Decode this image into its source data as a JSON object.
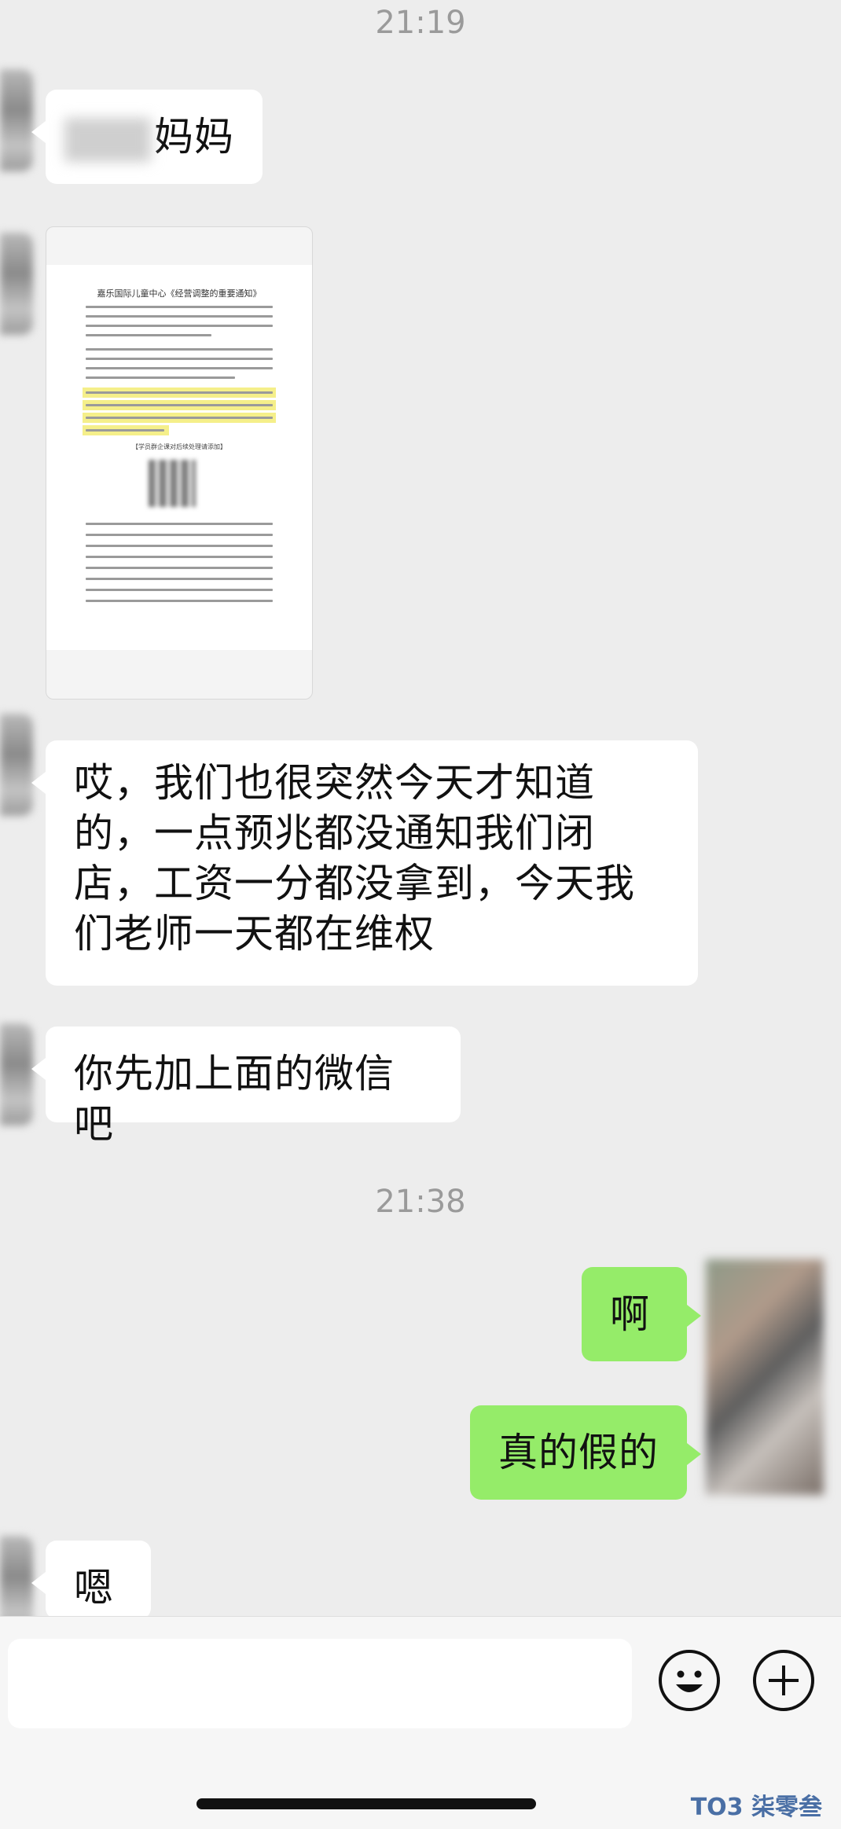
{
  "timestamps": [
    "21:19",
    "21:38"
  ],
  "messages": {
    "m1_suffix": "妈妈",
    "m3": "哎，我们也很突然今天才知道的，一点预兆都没通知我们闭店，工资一分都没拿到，今天我们老师一天都在维权",
    "m4": "你先加上面的微信吧",
    "m5": "啊",
    "m6": "真的假的",
    "m7": "嗯"
  },
  "file_card": {
    "doc_title": "嘉乐国际儿童中心《经营调整的重要通知》",
    "qr_caption": "【学员群企课对后续处理请添加】"
  },
  "input_bar": {
    "emoji_icon": "smile-icon",
    "plus_icon": "plus-icon",
    "emoji_glyph": "☺",
    "plus_glyph": "+"
  },
  "watermark": {
    "text": "TO3 柒零叁"
  }
}
